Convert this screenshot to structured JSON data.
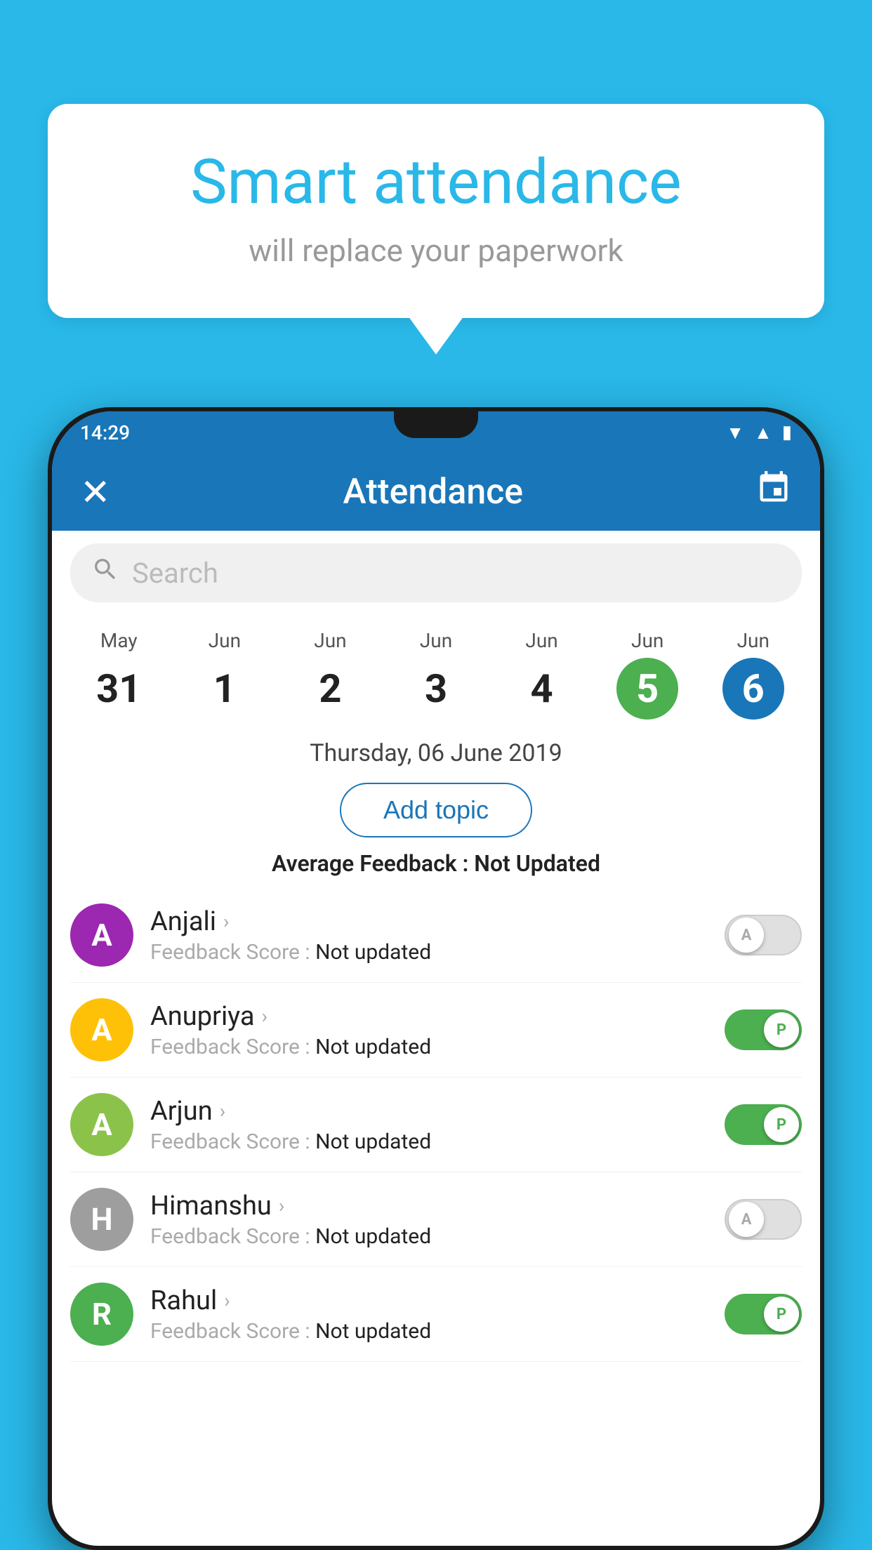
{
  "background_color": "#29b8e8",
  "bubble": {
    "title": "Smart attendance",
    "subtitle": "will replace your paperwork"
  },
  "status_bar": {
    "time": "14:29",
    "icons": [
      "▼",
      "▲",
      "🔋"
    ]
  },
  "app_bar": {
    "title": "Attendance",
    "close_icon": "✕",
    "calendar_icon": "📅"
  },
  "search": {
    "placeholder": "Search"
  },
  "calendar": {
    "days": [
      {
        "month": "May",
        "date": "31",
        "style": "normal"
      },
      {
        "month": "Jun",
        "date": "1",
        "style": "normal"
      },
      {
        "month": "Jun",
        "date": "2",
        "style": "normal"
      },
      {
        "month": "Jun",
        "date": "3",
        "style": "normal"
      },
      {
        "month": "Jun",
        "date": "4",
        "style": "normal"
      },
      {
        "month": "Jun",
        "date": "5",
        "style": "green"
      },
      {
        "month": "Jun",
        "date": "6",
        "style": "blue"
      }
    ]
  },
  "selected_date": "Thursday, 06 June 2019",
  "add_topic_label": "Add topic",
  "avg_feedback_label": "Average Feedback :",
  "avg_feedback_value": "Not Updated",
  "students": [
    {
      "name": "Anjali",
      "avatar_letter": "A",
      "avatar_color": "#9c27b0",
      "feedback_label": "Feedback Score :",
      "feedback_value": "Not updated",
      "toggle": "off",
      "toggle_label": "A"
    },
    {
      "name": "Anupriya",
      "avatar_letter": "A",
      "avatar_color": "#ffc107",
      "feedback_label": "Feedback Score :",
      "feedback_value": "Not updated",
      "toggle": "on",
      "toggle_label": "P"
    },
    {
      "name": "Arjun",
      "avatar_letter": "A",
      "avatar_color": "#8bc34a",
      "feedback_label": "Feedback Score :",
      "feedback_value": "Not updated",
      "toggle": "on",
      "toggle_label": "P"
    },
    {
      "name": "Himanshu",
      "avatar_letter": "H",
      "avatar_color": "#9e9e9e",
      "feedback_label": "Feedback Score :",
      "feedback_value": "Not updated",
      "toggle": "off",
      "toggle_label": "A"
    },
    {
      "name": "Rahul",
      "avatar_letter": "R",
      "avatar_color": "#4caf50",
      "feedback_label": "Feedback Score :",
      "feedback_value": "Not updated",
      "toggle": "on",
      "toggle_label": "P"
    }
  ]
}
